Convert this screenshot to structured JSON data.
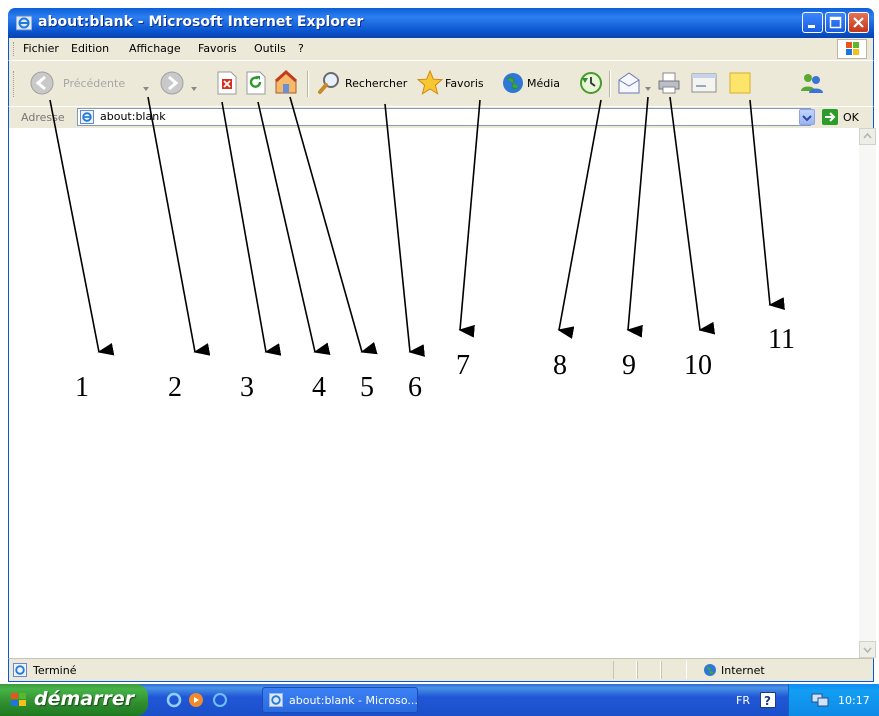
{
  "window": {
    "title": "about:blank - Microsoft Internet Explorer"
  },
  "menubar": {
    "items": [
      "Fichier",
      "Edition",
      "Affichage",
      "Favoris",
      "Outils",
      "?"
    ]
  },
  "toolbar": {
    "back_label": "Précédente",
    "search_label": "Rechercher",
    "favorites_label": "Favoris",
    "media_label": "Média"
  },
  "addressbar": {
    "label": "Adresse",
    "value": "about:blank",
    "go_label": "OK"
  },
  "statusbar": {
    "status": "Terminé",
    "zone": "Internet"
  },
  "taskbar": {
    "start_label": "démarrer",
    "task_label": "about:blank - Microso...",
    "lang": "FR",
    "clock": "10:17"
  },
  "annotations": [
    "1",
    "2",
    "3",
    "4",
    "5",
    "6",
    "7",
    "8",
    "9",
    "10",
    "11"
  ],
  "icons": [
    "ie-icon",
    "back-arrow-icon",
    "forward-arrow-icon",
    "stop-icon",
    "refresh-icon",
    "home-icon",
    "search-icon",
    "favorites-star-icon",
    "media-icon",
    "history-icon",
    "mail-icon",
    "print-icon",
    "edit-icon",
    "note-icon",
    "messenger-icon",
    "go-arrow-icon",
    "windows-logo-icon"
  ],
  "colors": {
    "title_bar": "#0a57d0",
    "chrome": "#ece9d8",
    "start_button": "#3c9a3c",
    "taskbar": "#2157d7"
  }
}
